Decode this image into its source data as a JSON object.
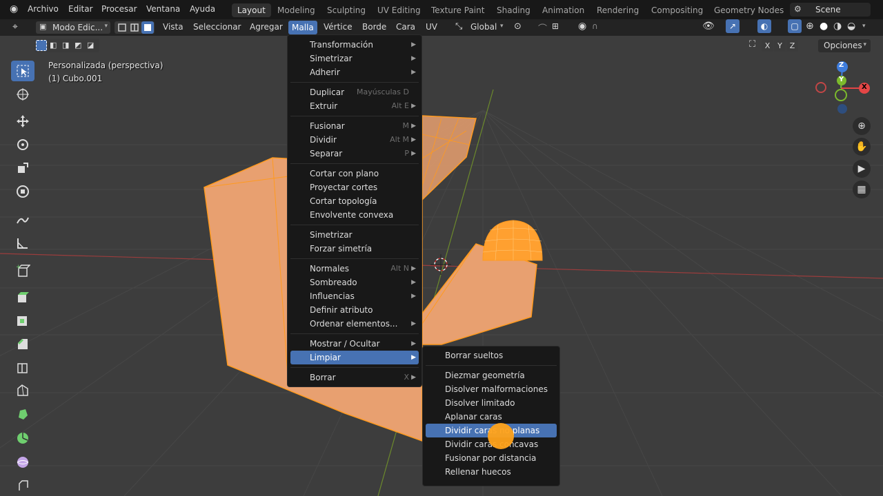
{
  "topbar": {
    "menu": [
      "Archivo",
      "Editar",
      "Procesar",
      "Ventana",
      "Ayuda"
    ],
    "workspaces": [
      "Layout",
      "Modeling",
      "Sculpting",
      "UV Editing",
      "Texture Paint",
      "Shading",
      "Animation",
      "Rendering",
      "Compositing",
      "Geometry Nodes"
    ],
    "active_workspace": "Layout",
    "scene": "Scene"
  },
  "header": {
    "mode": "Modo Edic...",
    "menus": [
      "Vista",
      "Seleccionar",
      "Agregar",
      "Malla",
      "Vértice",
      "Borde",
      "Cara",
      "UV"
    ],
    "active_menu": "Malla",
    "orientation": "Global",
    "axis": [
      "X",
      "Y",
      "Z"
    ],
    "options": "Opciones"
  },
  "viewport": {
    "view_name": "Personalizada (perspectiva)",
    "object_name": "(1) Cubo.001"
  },
  "gizmo": {
    "z": "Z",
    "y": "Y",
    "x": "X"
  },
  "malla_menu": {
    "groups": [
      [
        {
          "label": "Transformación",
          "shortcut": "",
          "sub": true
        },
        {
          "label": "Simetrizar",
          "shortcut": "",
          "sub": true
        },
        {
          "label": "Adherir",
          "shortcut": "",
          "sub": true
        }
      ],
      [
        {
          "label": "Duplicar",
          "shortcut": "Mayúsculas D",
          "sub": false
        },
        {
          "label": "Extruir",
          "shortcut": "Alt E",
          "sub": true
        }
      ],
      [
        {
          "label": "Fusionar",
          "shortcut": "M",
          "sub": true
        },
        {
          "label": "Dividir",
          "shortcut": "Alt M",
          "sub": true
        },
        {
          "label": "Separar",
          "shortcut": "P",
          "sub": true
        }
      ],
      [
        {
          "label": "Cortar con plano",
          "shortcut": "",
          "sub": false
        },
        {
          "label": "Proyectar cortes",
          "shortcut": "",
          "sub": false
        },
        {
          "label": "Cortar topología",
          "shortcut": "",
          "sub": false
        },
        {
          "label": "Envolvente convexa",
          "shortcut": "",
          "sub": false
        }
      ],
      [
        {
          "label": "Simetrizar",
          "shortcut": "",
          "sub": false
        },
        {
          "label": "Forzar simetría",
          "shortcut": "",
          "sub": false
        }
      ],
      [
        {
          "label": "Normales",
          "shortcut": "Alt N",
          "sub": true
        },
        {
          "label": "Sombreado",
          "shortcut": "",
          "sub": true
        },
        {
          "label": "Influencias",
          "shortcut": "",
          "sub": true
        },
        {
          "label": "Definir atributo",
          "shortcut": "",
          "sub": false
        },
        {
          "label": "Ordenar elementos...",
          "shortcut": "",
          "sub": true
        }
      ],
      [
        {
          "label": "Mostrar / Ocultar",
          "shortcut": "",
          "sub": true
        },
        {
          "label": "Limpiar",
          "shortcut": "",
          "sub": true,
          "highlighted": true
        }
      ],
      [
        {
          "label": "Borrar",
          "shortcut": "X",
          "sub": true
        }
      ]
    ]
  },
  "limpiar_menu": {
    "groups": [
      [
        {
          "label": "Borrar sueltos"
        }
      ],
      [
        {
          "label": "Diezmar geometría"
        },
        {
          "label": "Disolver malformaciones"
        },
        {
          "label": "Disolver limitado"
        },
        {
          "label": "Aplanar caras"
        },
        {
          "label": "Dividir caras no planas",
          "highlighted": true
        },
        {
          "label": "Dividir caras concavas"
        },
        {
          "label": "Fusionar por distancia"
        },
        {
          "label": "Rellenar huecos"
        }
      ]
    ]
  },
  "colors": {
    "accent": "#4772b3",
    "mesh_face": "#e8a070",
    "mesh_edge": "#ff9a1f",
    "cursor_dot": "#ffa21a"
  }
}
